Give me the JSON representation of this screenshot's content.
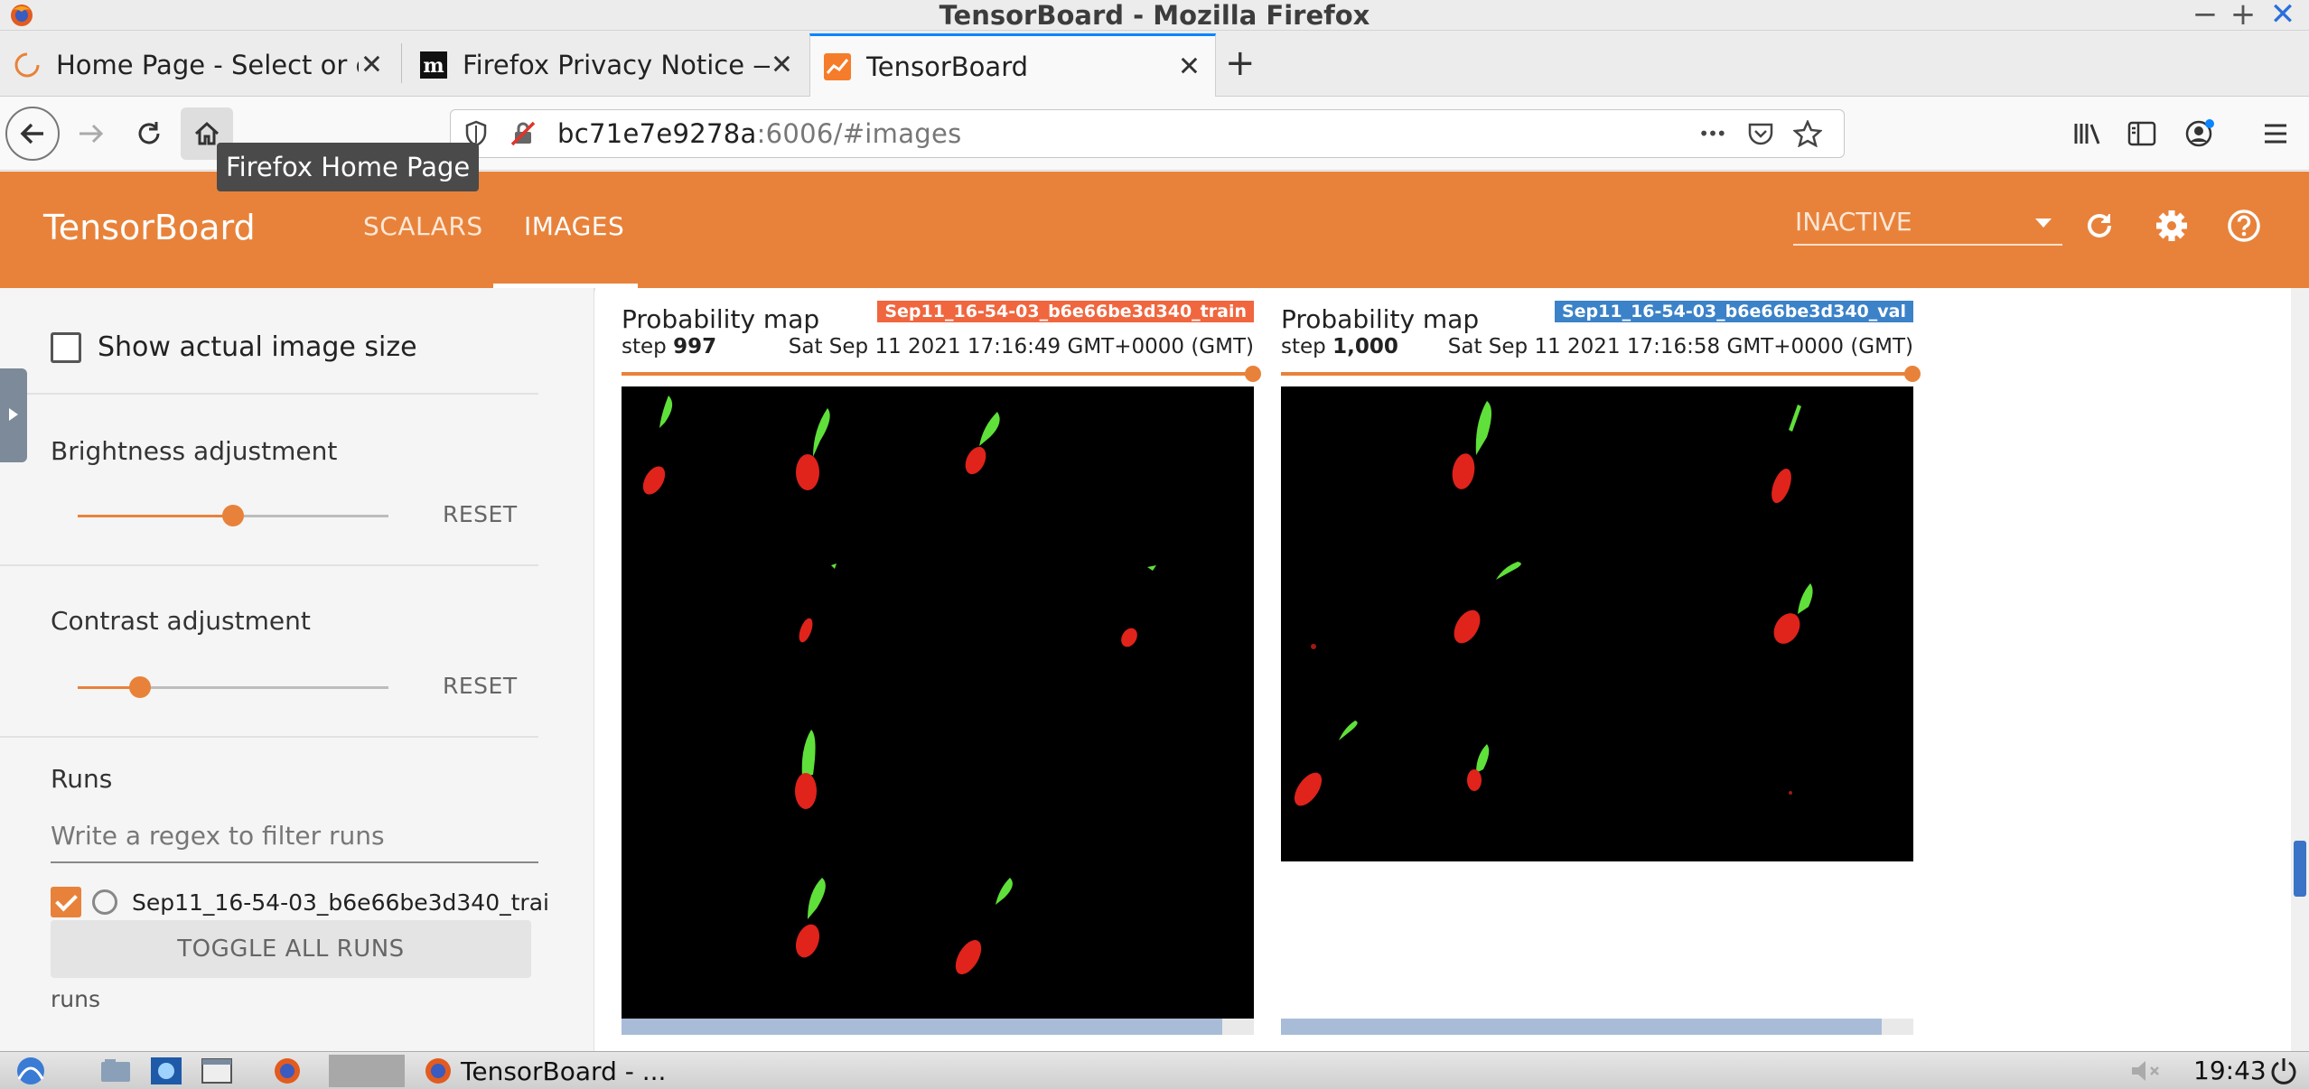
{
  "window": {
    "title": "TensorBoard - Mozilla Firefox",
    "minimize": "−",
    "maximize": "+",
    "close": "✕"
  },
  "tabs": [
    {
      "title": "Home Page - Select or cr",
      "icon": "loading-spinner-icon",
      "close": "✕"
    },
    {
      "title": "Firefox Privacy Notice —",
      "icon": "mozilla-m-icon",
      "close": "✕"
    },
    {
      "title": "TensorBoard",
      "icon": "tensorboard-icon",
      "close": "✕"
    }
  ],
  "new_tab": "+",
  "nav": {
    "url_host": "bc71e7e9278a",
    "url_rest": ":6006/#images",
    "home_tooltip": "Firefox Home Page",
    "more_dots": "•••"
  },
  "tensorboard": {
    "brand": "TensorBoard",
    "tabs": [
      "SCALARS",
      "IMAGES"
    ],
    "active_tab": "IMAGES",
    "run_status": "INACTIVE",
    "accent_color": "#e8823a"
  },
  "sidebar": {
    "show_actual_size": "Show actual image size",
    "show_actual_checked": false,
    "brightness": {
      "label": "Brightness adjustment",
      "reset": "RESET",
      "value": 0.5
    },
    "contrast": {
      "label": "Contrast adjustment",
      "reset": "RESET",
      "value": 0.2
    },
    "runs_title": "Runs",
    "runs_filter_placeholder": "Write a regex to filter runs",
    "runs": [
      {
        "name": "Sep11_16-54-03_b6e66be3d340_trai",
        "checked": true,
        "color": "#e8823a"
      }
    ],
    "toggle_all": "TOGGLE ALL RUNS",
    "footer": "runs"
  },
  "cards": [
    {
      "run_tag": "Sep11_16-54-03_b6e66be3d340_train",
      "tag_color": "#f0663f",
      "title": "Probability map",
      "step_label": "step",
      "step": "997",
      "time": "Sat Sep 11 2021 17:16:49 GMT+0000 (GMT)",
      "scroll_fraction": 0.95
    },
    {
      "run_tag": "Sep11_16-54-03_b6e66be3d340_val",
      "tag_color": "#3b82c8",
      "title": "Probability map",
      "step_label": "step",
      "step": "1,000",
      "time": "Sat Sep 11 2021 17:16:58 GMT+0000 (GMT)",
      "scroll_fraction": 0.95
    }
  ],
  "taskbar": {
    "window_label": "TensorBoard - ...",
    "clock": "19:43"
  }
}
